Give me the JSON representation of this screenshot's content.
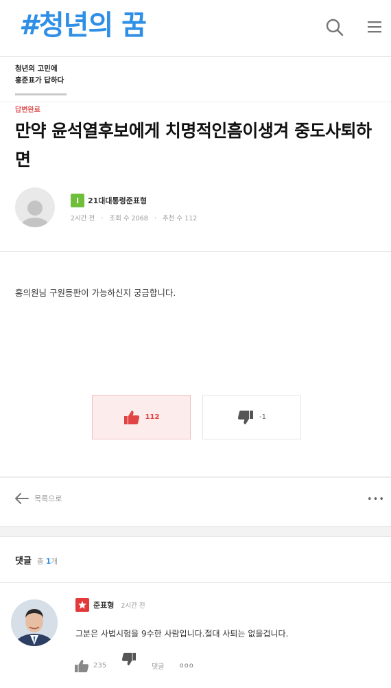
{
  "header": {
    "logo_hash": "#",
    "logo_text": "청년의 꿈",
    "search_icon": "search-icon",
    "menu_icon": "menu-icon",
    "brand_color": "#2f8fe6"
  },
  "subnav": {
    "tab_line1": "청년의 고민에",
    "tab_line2": "홍준표가 답하다"
  },
  "post": {
    "status": "답변완료",
    "title": "만약 윤석열후보에게 치명적인흠이생겨 중도사퇴하면",
    "author": {
      "level": "I",
      "name": "21대대통령준표형"
    },
    "meta": {
      "time": "2시간 전",
      "views": "조회 수 2068",
      "recommend": "추천 수 112"
    },
    "body": "홍의원님 구원등판이 가능하신지 궁금합니다.",
    "votes": {
      "up": "112",
      "down": "-1"
    }
  },
  "nav": {
    "back_label": "목록으로",
    "more": "•••"
  },
  "comments": {
    "header": "댓글",
    "total_prefix": "총",
    "total_count": "1",
    "total_suffix": "개",
    "items": [
      {
        "author": "준표형",
        "time": "2시간 전",
        "text": "그분은 사법시험을 9수한 사람입니다.절대 사퇴는 없을겁니다.",
        "likes": "235",
        "reply": "댓글",
        "more": "ooo"
      }
    ]
  }
}
